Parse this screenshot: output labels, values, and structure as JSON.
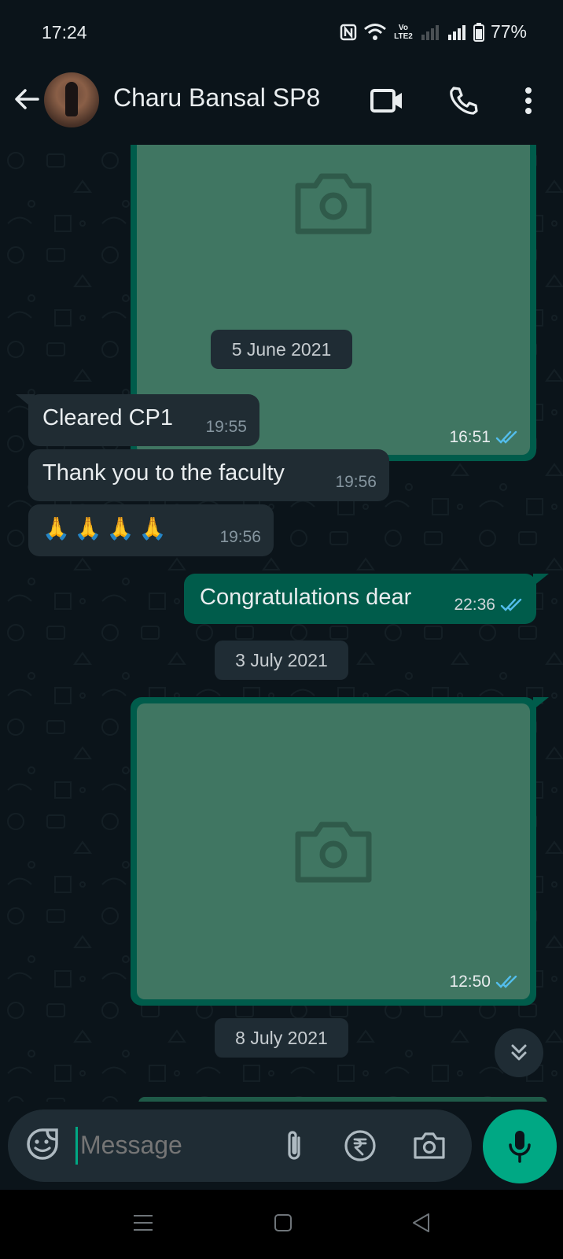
{
  "status_bar": {
    "time": "17:24",
    "network": "Vo LTE2",
    "battery": "77%"
  },
  "header": {
    "contact_name": "Charu Bansal SP8"
  },
  "messages": [
    {
      "type": "image",
      "direction": "out",
      "time": "16:51",
      "status": "read"
    },
    {
      "type": "date",
      "label": "5 June 2021"
    },
    {
      "type": "text",
      "direction": "in",
      "text": "Cleared CP1",
      "time": "19:55"
    },
    {
      "type": "text",
      "direction": "in",
      "text": "Thank you to the faculty",
      "time": "19:56"
    },
    {
      "type": "text",
      "direction": "in",
      "text": "🙏🙏🙏🙏",
      "time": "19:56"
    },
    {
      "type": "text",
      "direction": "out",
      "text": "Congratulations dear",
      "time": "22:36",
      "status": "read"
    },
    {
      "type": "date",
      "label": "3 July 2021"
    },
    {
      "type": "image",
      "direction": "out",
      "time": "12:50",
      "status": "read"
    },
    {
      "type": "date",
      "label": "8 July 2021"
    }
  ],
  "composer": {
    "placeholder": "Message"
  },
  "colors": {
    "accent": "#00a884",
    "bubble_out": "#005c4b",
    "bubble_in": "#202c33",
    "read_tick": "#53bdeb",
    "background": "#0b141a"
  },
  "icons": [
    "back-arrow-icon",
    "video-call-icon",
    "voice-call-icon",
    "more-options-icon",
    "camera-icon",
    "double-check-icon",
    "emoji-sticker-icon",
    "attach-icon",
    "rupee-payment-icon",
    "camera-capture-icon",
    "mic-icon",
    "chevron-double-down-icon",
    "nav-menu-icon",
    "nav-home-icon",
    "nav-back-icon"
  ]
}
